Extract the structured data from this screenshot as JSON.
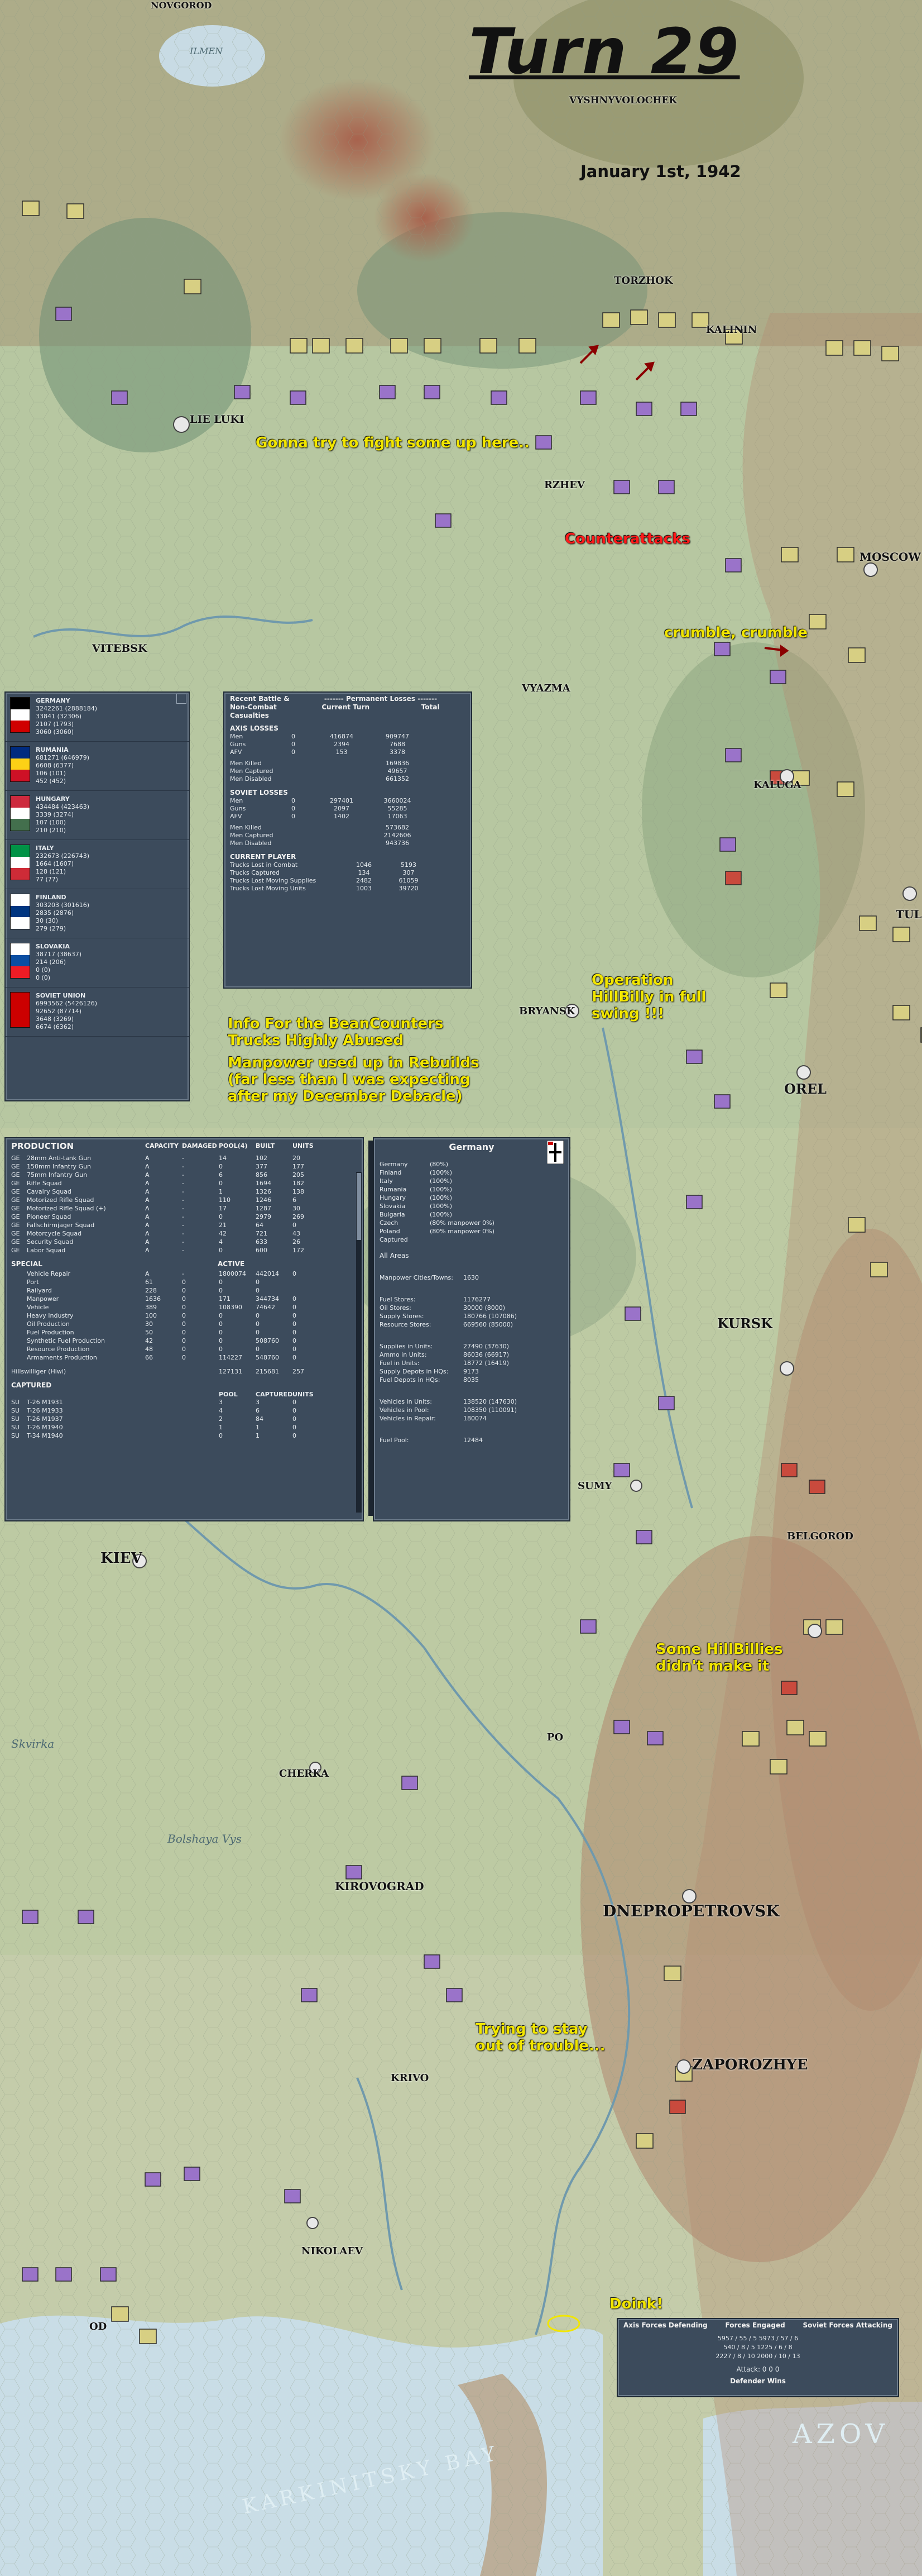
{
  "title": "Turn 29",
  "date": "January 1st, 1942",
  "annotations": {
    "fight_up_here": "Gonna try to fight some up here..",
    "counterattacks": "Counterattacks",
    "crumble": "crumble, crumble",
    "hillbilly": "Operation HillBilly in full swing !!!",
    "beancounters_1": "Info For the BeanCounters",
    "beancounters_2": "Trucks Highly Abused",
    "manpower_1": "Manpower used up in Rebuilds",
    "manpower_2": "(far less than I was expecting",
    "manpower_3": "after my December Debacle)",
    "hillbillies_1": "Some HillBillies",
    "hillbillies_2": "didn't make it",
    "trying_1": "Trying to stay",
    "trying_2": "out of trouble...",
    "doink": "Doink!"
  },
  "cities": {
    "novgorod": "NOVGOROD",
    "ilmen": "ILMEN",
    "vyshny": "VYSHNYVOLOCHEK",
    "torzhok": "TORZHOK",
    "kalinin": "KALININ",
    "lieluki": "LIE LUKI",
    "rzhev": "RZHEV",
    "moscow": "MOSCOW",
    "vitebsk": "VITEBSK",
    "vyazma": "VYAZMA",
    "kaluga": "KALUGA",
    "tula": "TUL",
    "bryansk": "BRYANSK",
    "orel": "OREL",
    "kursk": "KURSK",
    "sumy": "SUMY",
    "kiev": "KIEV",
    "belgorod": "BELGOROD",
    "poltava": "PO",
    "cherkassy": "CHERKA",
    "kirovograd": "KIROVOGRAD",
    "dnepropetrovsk": "DNEPROPETROVSK",
    "zaporozhye": "ZAPOROZHYE",
    "krivoi": "KRIVO",
    "nikolaev": "NIKOLAEV",
    "odessa": "OD",
    "skvirka": "Skvirka",
    "bolshaya": "Bolshaya Vys",
    "karkinitsky": "KARKINITSKY BAY",
    "azov": "AZOV"
  },
  "losses_panel": {
    "headers": {
      "col1": "Recent Battle & Non-Combat Casualties",
      "col2": "Current Turn",
      "col3": "Total",
      "permanent": "------- Permanent Losses -------"
    },
    "axis_title": "AXIS LOSSES",
    "axis_rows": [
      {
        "label": "Men",
        "current": "0",
        "turn": "416874",
        "total": "909747"
      },
      {
        "label": "Guns",
        "current": "0",
        "turn": "2394",
        "total": "7688"
      },
      {
        "label": "AFV",
        "current": "0",
        "turn": "153",
        "total": "3378"
      }
    ],
    "axis_perm": [
      {
        "label": "Men Killed",
        "value": "169836"
      },
      {
        "label": "Men Captured",
        "value": "49657"
      },
      {
        "label": "Men Disabled",
        "value": "661352"
      }
    ],
    "soviet_title": "SOVIET LOSSES",
    "soviet_rows": [
      {
        "label": "Men",
        "current": "0",
        "turn": "297401",
        "total": "3660024"
      },
      {
        "label": "Guns",
        "current": "0",
        "turn": "2097",
        "total": "55285"
      },
      {
        "label": "AFV",
        "current": "0",
        "turn": "1402",
        "total": "17063"
      }
    ],
    "soviet_perm": [
      {
        "label": "Men Killed",
        "value": "573682"
      },
      {
        "label": "Men Captured",
        "value": "2142606"
      },
      {
        "label": "Men Disabled",
        "value": "943736"
      }
    ],
    "player_title": "CURRENT PLAYER",
    "player_rows": [
      {
        "label": "Trucks Lost in Combat",
        "a": "1046",
        "b": "5193"
      },
      {
        "label": "Trucks Captured",
        "a": "134",
        "b": "307"
      },
      {
        "label": "Trucks Lost Moving Supplies",
        "a": "2482",
        "b": "61059"
      },
      {
        "label": "Trucks Lost Moving Units",
        "a": "1003",
        "b": "39720"
      }
    ]
  },
  "nations_panel": [
    {
      "name": "GERMANY",
      "v1": "3242261 (2888184)",
      "v2": "33841 (32306)",
      "v3": "2107 (1793)",
      "v4": "3060 (3060)",
      "colors": [
        "#000000",
        "#ffffff",
        "#d00000"
      ]
    },
    {
      "name": "RUMANIA",
      "v1": "681271 (646979)",
      "v2": "6608 (6377)",
      "v3": "106 (101)",
      "v4": "452 (452)",
      "colors": [
        "#002b7f",
        "#fcd116",
        "#ce1126"
      ]
    },
    {
      "name": "HUNGARY",
      "v1": "434484 (423463)",
      "v2": "3339 (3274)",
      "v3": "107 (100)",
      "v4": "210 (210)",
      "colors": [
        "#cd2a3e",
        "#ffffff",
        "#436f4d"
      ]
    },
    {
      "name": "ITALY",
      "v1": "232673 (226743)",
      "v2": "1664 (1607)",
      "v3": "128 (121)",
      "v4": "77 (77)",
      "colors": [
        "#009246",
        "#ffffff",
        "#ce2b37"
      ]
    },
    {
      "name": "FINLAND",
      "v1": "303203 (301616)",
      "v2": "2835 (2876)",
      "v3": "30 (30)",
      "v4": "279 (279)",
      "colors": [
        "#ffffff",
        "#003580",
        "#ffffff"
      ]
    },
    {
      "name": "SLOVAKIA",
      "v1": "38717 (38637)",
      "v2": "214 (206)",
      "v3": "0 (0)",
      "v4": "0 (0)",
      "colors": [
        "#ffffff",
        "#0b4ea2",
        "#ee1c25"
      ]
    },
    {
      "name": "SOVIET UNION",
      "v1": "6993562 (5426126)",
      "v2": "92652 (87714)",
      "v3": "3648 (3269)",
      "v4": "6674 (6362)",
      "colors": [
        "#cc0000",
        "#cc0000",
        "#cc0000"
      ]
    }
  ],
  "production_panel": {
    "title": "PRODUCTION",
    "columns": [
      "CAPACITY",
      "DAMAGED",
      "POOL(4)",
      "BUILT",
      "UNITS"
    ],
    "rows": [
      {
        "n": "GE",
        "item": "28mm Anti-tank Gun",
        "c": "A",
        "d": "-",
        "p": "14",
        "b": "102",
        "u": "20"
      },
      {
        "n": "GE",
        "item": "150mm Infantry Gun",
        "c": "A",
        "d": "-",
        "p": "0",
        "b": "377",
        "u": "177"
      },
      {
        "n": "GE",
        "item": "75mm Infantry Gun",
        "c": "A",
        "d": "-",
        "p": "6",
        "b": "856",
        "u": "205"
      },
      {
        "n": "GE",
        "item": "Rifle Squad",
        "c": "A",
        "d": "-",
        "p": "0",
        "b": "1694",
        "u": "182"
      },
      {
        "n": "GE",
        "item": "Cavalry Squad",
        "c": "A",
        "d": "-",
        "p": "1",
        "b": "1326",
        "u": "138"
      },
      {
        "n": "GE",
        "item": "Motorized Rifle Squad",
        "c": "A",
        "d": "-",
        "p": "110",
        "b": "1246",
        "u": "6"
      },
      {
        "n": "GE",
        "item": "Motorized Rifle Squad (+)",
        "c": "A",
        "d": "-",
        "p": "17",
        "b": "1287",
        "u": "30"
      },
      {
        "n": "GE",
        "item": "Pioneer Squad",
        "c": "A",
        "d": "-",
        "p": "0",
        "b": "2979",
        "u": "269"
      },
      {
        "n": "GE",
        "item": "Fallschirmjager Squad",
        "c": "A",
        "d": "-",
        "p": "21",
        "b": "64",
        "u": "0"
      },
      {
        "n": "GE",
        "item": "Motorcycle Squad",
        "c": "A",
        "d": "-",
        "p": "42",
        "b": "721",
        "u": "43"
      },
      {
        "n": "GE",
        "item": "Security Squad",
        "c": "A",
        "d": "-",
        "p": "4",
        "b": "633",
        "u": "26"
      },
      {
        "n": "GE",
        "item": "Labor Squad",
        "c": "A",
        "d": "-",
        "p": "0",
        "b": "600",
        "u": "172"
      }
    ],
    "special_title": "SPECIAL",
    "special_cols": [
      "ACTIVE"
    ],
    "special_rows": [
      {
        "item": "Vehicle Repair",
        "c": "A",
        "d": "-",
        "p": "1800074",
        "b": "442014",
        "u": "0"
      },
      {
        "item": "Port",
        "c": "61",
        "d": "0",
        "p": "0",
        "b": "0",
        "u": ""
      },
      {
        "item": "Railyard",
        "c": "228",
        "d": "0",
        "p": "0",
        "b": "0",
        "u": ""
      },
      {
        "item": "Manpower",
        "c": "1636",
        "d": "0",
        "p": "171",
        "b": "344734",
        "u": "0"
      },
      {
        "item": "Vehicle",
        "c": "389",
        "d": "0",
        "p": "108390",
        "b": "74642",
        "u": "0"
      },
      {
        "item": "Heavy Industry",
        "c": "100",
        "d": "0",
        "p": "0",
        "b": "0",
        "u": "0"
      },
      {
        "item": "Oil Production",
        "c": "30",
        "d": "0",
        "p": "0",
        "b": "0",
        "u": "0"
      },
      {
        "item": "Fuel Production",
        "c": "50",
        "d": "0",
        "p": "0",
        "b": "0",
        "u": "0"
      },
      {
        "item": "Synthetic Fuel Production",
        "c": "42",
        "d": "0",
        "p": "0",
        "b": "508760",
        "u": "0"
      },
      {
        "item": "Resource Production",
        "c": "48",
        "d": "0",
        "p": "0",
        "b": "0",
        "u": "0"
      },
      {
        "item": "Armaments Production",
        "c": "66",
        "d": "0",
        "p": "114227",
        "b": "548760",
        "u": "0"
      }
    ],
    "hillswilliger": {
      "item": "Hillswilliger (Hiwi)",
      "p": "127131",
      "b": "215681",
      "u": "257"
    },
    "captured_title": "CAPTURED",
    "captured_cols": [
      "POOL",
      "CAPTURED",
      "UNITS"
    ],
    "captured_rows": [
      {
        "n": "SU",
        "item": "T-26 M1931",
        "p": "3",
        "c": "3",
        "u": "0"
      },
      {
        "n": "SU",
        "item": "T-26 M1933",
        "p": "4",
        "c": "6",
        "u": "0"
      },
      {
        "n": "SU",
        "item": "T-26 M1937",
        "p": "2",
        "c": "84",
        "u": "0"
      },
      {
        "n": "SU",
        "item": "T-26 M1940",
        "p": "1",
        "c": "1",
        "u": "0"
      },
      {
        "n": "SU",
        "item": "T-34 M1940",
        "p": "0",
        "c": "1",
        "u": "0"
      }
    ]
  },
  "germany_panel": {
    "title": "Germany",
    "nations": [
      {
        "name": "Germany",
        "val": "(80%)"
      },
      {
        "name": "Finland",
        "val": "(100%)"
      },
      {
        "name": "Italy",
        "val": "(100%)"
      },
      {
        "name": "Rumania",
        "val": "(100%)"
      },
      {
        "name": "Hungary",
        "val": "(100%)"
      },
      {
        "name": "Slovakia",
        "val": "(100%)"
      },
      {
        "name": "Bulgaria",
        "val": "(100%)"
      },
      {
        "name": "Czech",
        "val": "(80% manpower 0%)"
      },
      {
        "name": "Poland",
        "val": "(80% manpower 0%)"
      },
      {
        "name": "Captured",
        "val": ""
      }
    ],
    "all_areas": "All Areas",
    "stats1": [
      {
        "label": "Manpower Cities/Towns:",
        "val": "1630"
      }
    ],
    "stats2": [
      {
        "label": "Fuel Stores:",
        "val": "1176277"
      },
      {
        "label": "Oil Stores:",
        "val": "30000 (8000)"
      },
      {
        "label": "Supply Stores:",
        "val": "180766 (107086)"
      },
      {
        "label": "Resource Stores:",
        "val": "669560 (85000)"
      }
    ],
    "stats3": [
      {
        "label": "Supplies in Units:",
        "val": "27490 (37630)"
      },
      {
        "label": "Ammo in Units:",
        "val": "86036 (66917)"
      },
      {
        "label": "Fuel in Units:",
        "val": "18772 (16419)"
      },
      {
        "label": "Supply Depots in HQs:",
        "val": "9173"
      },
      {
        "label": "Fuel Depots in HQs:",
        "val": "8035"
      }
    ],
    "stats4": [
      {
        "label": "Vehicles in Units:",
        "val": "138520 (147630)"
      },
      {
        "label": "Vehicles in Pool:",
        "val": "108350 (110091)"
      },
      {
        "label": "Vehicles in Repair:",
        "val": "180074"
      }
    ],
    "stats5": [
      {
        "label": "Fuel Pool:",
        "val": "12484"
      }
    ]
  },
  "battle_panel": {
    "left_title": "Axis Forces Defending",
    "mid_title": "Forces Engaged",
    "right_title": "Soviet Forces Attacking",
    "mid_rows": [
      "5957 / 55 / 5     5973 / 57 / 6",
      "540 / 8 / 5     1225 / 6 / 8",
      "2227 / 8 / 10     2000 / 10 / 13"
    ],
    "bottom": "Attack: 0 0 0",
    "footer": "Defender Wins"
  },
  "colors": {
    "panel_bg": "#3c4b5c",
    "note_yellow": "#f2e600",
    "note_red": "#ff1a1a",
    "german_counter": "#d7cf83",
    "soviet_counter": "#9a73c9"
  }
}
